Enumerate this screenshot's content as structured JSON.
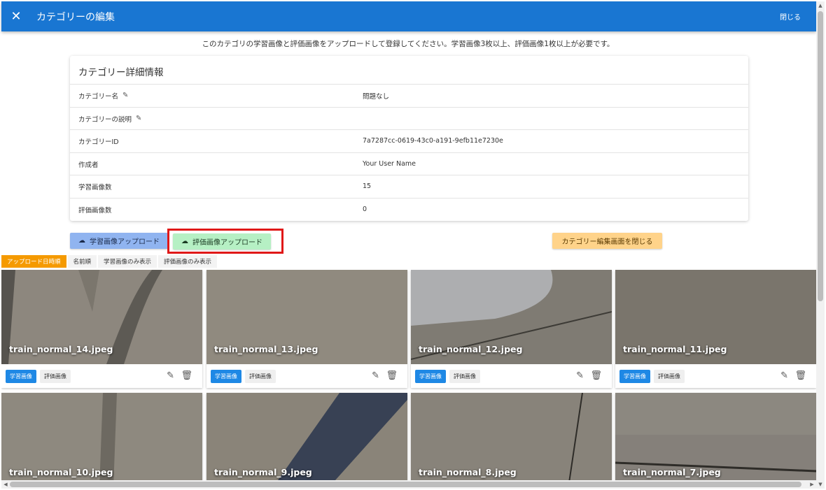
{
  "dialog": {
    "title": "カテゴリーの編集",
    "close_label": "閉じる",
    "notice": "このカテゴリの学習画像と評価画像をアップロードして登録してください。学習画像3枚以上、評価画像1枚以上が必要です。"
  },
  "details": {
    "title": "カテゴリー詳細情報",
    "rows": [
      {
        "label": "カテゴリー名",
        "value": "問題なし",
        "editable": true
      },
      {
        "label": "カテゴリーの説明",
        "value": "",
        "editable": true
      },
      {
        "label": "カテゴリーID",
        "value": "7a7287cc-0619-43c0-a191-9efb11e7230e",
        "editable": false
      },
      {
        "label": "作成者",
        "value": "Your User Name",
        "editable": false
      },
      {
        "label": "学習画像数",
        "value": "15",
        "editable": false
      },
      {
        "label": "評価画像数",
        "value": "0",
        "editable": false
      }
    ]
  },
  "buttons": {
    "upload_train": "学習画像アップロード",
    "upload_eval": "評価画像アップロード",
    "close_edit": "カテゴリー編集画面を閉じる"
  },
  "sort_tabs": [
    "アップロード日時順",
    "名前順",
    "学習画像のみ表示",
    "評価画像のみ表示"
  ],
  "chips": {
    "train": "学習画像",
    "eval": "評価画像"
  },
  "images": [
    {
      "name": "train_normal_14.jpeg"
    },
    {
      "name": "train_normal_13.jpeg"
    },
    {
      "name": "train_normal_12.jpeg"
    },
    {
      "name": "train_normal_11.jpeg"
    },
    {
      "name": "train_normal_10.jpeg"
    },
    {
      "name": "train_normal_9.jpeg"
    },
    {
      "name": "train_normal_8.jpeg"
    },
    {
      "name": "train_normal_7.jpeg"
    }
  ],
  "colors": {
    "appbar": "#1976d2",
    "active_tab": "#f59a00",
    "highlight": "#e01818"
  }
}
